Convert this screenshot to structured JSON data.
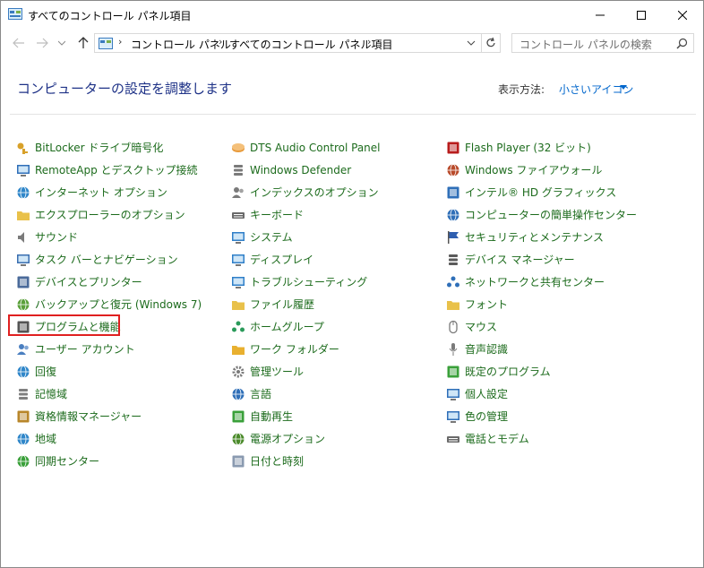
{
  "window": {
    "title": "すべてのコントロール パネル項目"
  },
  "nav": {
    "breadcrumb": [
      "コントロール パネル",
      "すべてのコントロール パネル項目"
    ],
    "search_placeholder": "コントロール パネルの検索"
  },
  "header": {
    "title": "コンピューターの設定を調整します",
    "view_label": "表示方法:",
    "view_value": "小さいアイコン"
  },
  "columns": [
    [
      {
        "label": "BitLocker ドライブ暗号化",
        "icon": "bitlocker-key-icon"
      },
      {
        "label": "RemoteApp とデスクトップ接続",
        "icon": "remoteapp-icon"
      },
      {
        "label": "インターネット オプション",
        "icon": "globe-icon"
      },
      {
        "label": "エクスプローラーのオプション",
        "icon": "folder-options-icon"
      },
      {
        "label": "サウンド",
        "icon": "speaker-icon"
      },
      {
        "label": "タスク バーとナビゲーション",
        "icon": "taskbar-icon"
      },
      {
        "label": "デバイスとプリンター",
        "icon": "printer-icon"
      },
      {
        "label": "バックアップと復元 (Windows 7)",
        "icon": "backup-icon"
      },
      {
        "label": "プログラムと機能",
        "icon": "programs-icon"
      },
      {
        "label": "ユーザー アカウント",
        "icon": "users-icon"
      },
      {
        "label": "回復",
        "icon": "recovery-icon"
      },
      {
        "label": "記憶域",
        "icon": "storage-icon"
      },
      {
        "label": "資格情報マネージャー",
        "icon": "vault-icon"
      },
      {
        "label": "地域",
        "icon": "region-globe-icon"
      },
      {
        "label": "同期センター",
        "icon": "sync-icon"
      }
    ],
    [
      {
        "label": "DTS Audio Control Panel",
        "icon": "dts-icon"
      },
      {
        "label": "Windows Defender",
        "icon": "defender-icon"
      },
      {
        "label": "インデックスのオプション",
        "icon": "indexing-icon"
      },
      {
        "label": "キーボード",
        "icon": "keyboard-icon"
      },
      {
        "label": "システム",
        "icon": "system-monitor-icon"
      },
      {
        "label": "ディスプレイ",
        "icon": "display-icon"
      },
      {
        "label": "トラブルシューティング",
        "icon": "troubleshoot-icon"
      },
      {
        "label": "ファイル履歴",
        "icon": "file-history-icon"
      },
      {
        "label": "ホームグループ",
        "icon": "homegroup-icon"
      },
      {
        "label": "ワーク フォルダー",
        "icon": "work-folders-icon"
      },
      {
        "label": "管理ツール",
        "icon": "admin-tools-icon"
      },
      {
        "label": "言語",
        "icon": "language-icon"
      },
      {
        "label": "自動再生",
        "icon": "autoplay-icon"
      },
      {
        "label": "電源オプション",
        "icon": "power-icon"
      },
      {
        "label": "日付と時刻",
        "icon": "calendar-clock-icon"
      }
    ],
    [
      {
        "label": "Flash Player (32 ビット)",
        "icon": "flash-icon"
      },
      {
        "label": "Windows ファイアウォール",
        "icon": "firewall-icon"
      },
      {
        "label": "インテル® HD グラフィックス",
        "icon": "intel-graphics-icon"
      },
      {
        "label": "コンピューターの簡単操作センター",
        "icon": "ease-of-access-icon"
      },
      {
        "label": "セキュリティとメンテナンス",
        "icon": "flag-icon"
      },
      {
        "label": "デバイス マネージャー",
        "icon": "device-manager-icon"
      },
      {
        "label": "ネットワークと共有センター",
        "icon": "network-icon"
      },
      {
        "label": "フォント",
        "icon": "fonts-icon"
      },
      {
        "label": "マウス",
        "icon": "mouse-icon"
      },
      {
        "label": "音声認識",
        "icon": "microphone-icon"
      },
      {
        "label": "既定のプログラム",
        "icon": "default-programs-icon"
      },
      {
        "label": "個人設定",
        "icon": "personalization-icon"
      },
      {
        "label": "色の管理",
        "icon": "color-management-icon"
      },
      {
        "label": "電話とモデム",
        "icon": "phone-modem-icon"
      }
    ]
  ]
}
